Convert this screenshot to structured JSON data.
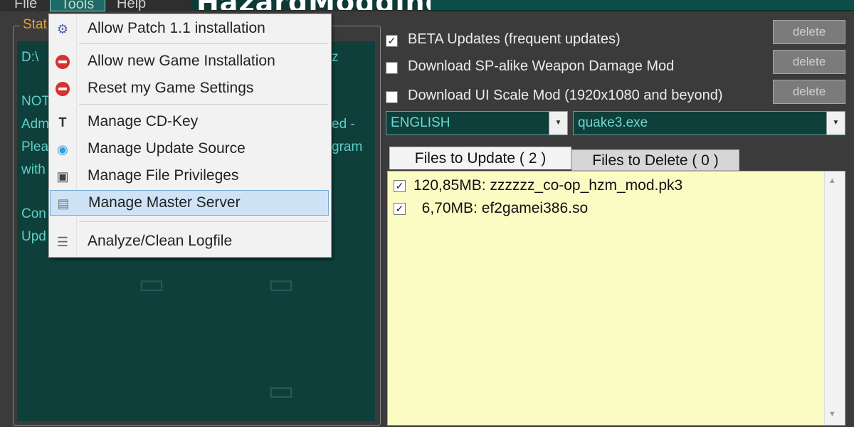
{
  "menubar": {
    "file": "File",
    "tools": "Tools",
    "help": "Help",
    "logo": "HazardModding"
  },
  "status": {
    "legend": "Stat",
    "lines": [
      "D:\\",
      "NOT",
      "Adm",
      "Plea",
      "with",
      "Con",
      "Upd"
    ],
    "right_fragments": [
      "z",
      "ed -",
      "gram"
    ]
  },
  "tools_menu": {
    "items": [
      {
        "icon": "patch-icon",
        "label": "Allow Patch 1.1 installation"
      },
      {
        "icon": "stop-icon",
        "label": "Allow new Game Installation"
      },
      {
        "icon": "stop-icon",
        "label": "Reset my Game Settings"
      },
      {
        "icon": "key-icon",
        "label": "Manage CD-Key"
      },
      {
        "icon": "update-source-icon",
        "label": "Manage Update Source"
      },
      {
        "icon": "save-icon",
        "label": "Manage File Privileges"
      },
      {
        "icon": "server-icon",
        "label": "Manage Master Server"
      },
      {
        "icon": "logfile-icon",
        "label": "Analyze/Clean Logfile"
      }
    ]
  },
  "options": {
    "beta_updates": {
      "label": "BETA Updates (frequent updates)",
      "checked": true
    },
    "sp_weapon_mod": {
      "label": "Download SP-alike Weapon Damage Mod",
      "checked": false
    },
    "ui_scale_mod": {
      "label": "Download UI Scale Mod (1920x1080 and beyond)",
      "checked": false
    },
    "delete_label": "delete"
  },
  "combos": {
    "language": "ENGLISH",
    "executable": "quake3.exe"
  },
  "tabs": {
    "update": "Files to Update ( 2 )",
    "delete": "Files to Delete ( 0 )"
  },
  "files": [
    {
      "text": "120,85MB: zzzzzz_co-op_hzm_mod.pk3",
      "checked": true
    },
    {
      "text": "  6,70MB: ef2gamei386.so",
      "checked": true
    }
  ],
  "colors": {
    "panel_teal": "#0f3f3b",
    "list_yellow": "#fbfbc4",
    "highlight": "#cfe3f7"
  }
}
